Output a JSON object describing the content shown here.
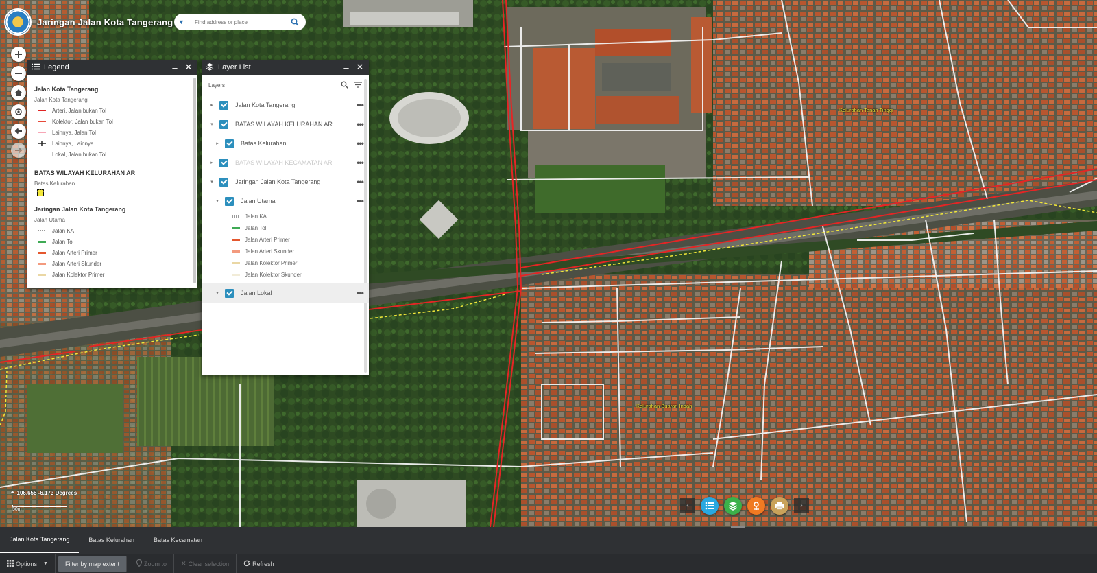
{
  "app": {
    "title": "Jaringan Jalan Kota Tangerang"
  },
  "search": {
    "placeholder": "Find address or place",
    "source_icon": "chevron-down-icon",
    "button_icon": "search-icon"
  },
  "nav": [
    {
      "name": "zoom-in-icon",
      "glyph": "+"
    },
    {
      "name": "zoom-out-icon",
      "glyph": "−"
    },
    {
      "name": "home-icon",
      "glyph": "⌂"
    },
    {
      "name": "locate-icon",
      "glyph": "◎"
    },
    {
      "name": "back-icon",
      "glyph": "←"
    },
    {
      "name": "forward-icon",
      "glyph": "→"
    }
  ],
  "legend": {
    "title": "Legend",
    "groups": [
      {
        "title": "Jalan Kota Tangerang",
        "sub": "Jalan Kota Tangerang",
        "items": [
          {
            "label": "Arteri, Jalan bukan Tol",
            "color": "#e02424"
          },
          {
            "label": "Kolektor, Jalan bukan Tol",
            "color": "#e64a3a"
          },
          {
            "label": "Lainnya, Jalan Tol",
            "color": "#f7a6b6"
          },
          {
            "label": "Lainnya, Lainnya",
            "color": "#222222"
          },
          {
            "label": "Lokal, Jalan bukan Tol",
            "color": "#ffffff"
          }
        ]
      },
      {
        "title": "BATAS WILAYAH KELURAHAN AR",
        "sub": "Batas Kelurahan",
        "items": []
      },
      {
        "title": "Jaringan Jalan Kota Tangerang",
        "sub": "Jalan Utama",
        "items": [
          {
            "label": "Jalan KA",
            "color": "#9a9a9a"
          },
          {
            "label": "Jalan Tol",
            "color": "#3faa55"
          },
          {
            "label": "Jalan Arteri Primer",
            "color": "#e4572e"
          },
          {
            "label": "Jalan Arteri Skunder",
            "color": "#f39a7e"
          },
          {
            "label": "Jalan Kolektor Primer",
            "color": "#ead7a4"
          }
        ]
      }
    ]
  },
  "layer_list": {
    "title": "Layer List",
    "header_label": "Layers",
    "rows": [
      {
        "label": "Jalan Kota Tangerang",
        "level": 0,
        "dim": false
      },
      {
        "label": "BATAS WILAYAH KELURAHAN AR",
        "level": 0,
        "dim": false
      },
      {
        "label": "Batas Kelurahan",
        "level": 1,
        "dim": false
      },
      {
        "label": "BATAS WILAYAH KECAMATAN AR",
        "level": 0,
        "dim": true
      },
      {
        "label": "Jaringan Jalan Kota Tangerang",
        "level": 0,
        "dim": false
      },
      {
        "label": "Jalan Utama",
        "level": 1,
        "dim": false
      }
    ],
    "sublegend": [
      {
        "label": "Jalan KA",
        "color": "#9a9a9a"
      },
      {
        "label": "Jalan Tol",
        "color": "#3faa55"
      },
      {
        "label": "Jalan Arteri Primer",
        "color": "#e4572e"
      },
      {
        "label": "Jalan Arteri Skunder",
        "color": "#f39a7e"
      },
      {
        "label": "Jalan Kolektor Primer",
        "color": "#ead7a4"
      },
      {
        "label": "Jalan Kolektor Skunder",
        "color": "#f2ecd8"
      }
    ],
    "last_row": {
      "label": "Jalan Lokal"
    }
  },
  "map": {
    "labels": [
      "Kelurahan Tanah Tinggi",
      "Kelurahan Buaran Indah"
    ],
    "coords": "106.655 -6.173 Degrees",
    "scale": "50m"
  },
  "dock": {
    "buttons": [
      {
        "name": "legend-widget-icon",
        "color": "#29a8e0"
      },
      {
        "name": "layer-list-widget-icon",
        "color": "#3bb14a"
      },
      {
        "name": "measure-widget-icon",
        "color": "#f07a22"
      },
      {
        "name": "print-widget-icon",
        "color": "#c9a25a"
      }
    ]
  },
  "attribute_table": {
    "tabs": [
      "Jalan Kota Tangerang",
      "Batas Kelurahan",
      "Batas Kecamatan"
    ],
    "active_tab": 0,
    "tools": {
      "options": "Options",
      "filter": "Filter by map extent",
      "zoom": "Zoom to",
      "clear": "Clear selection",
      "refresh": "Refresh"
    }
  }
}
